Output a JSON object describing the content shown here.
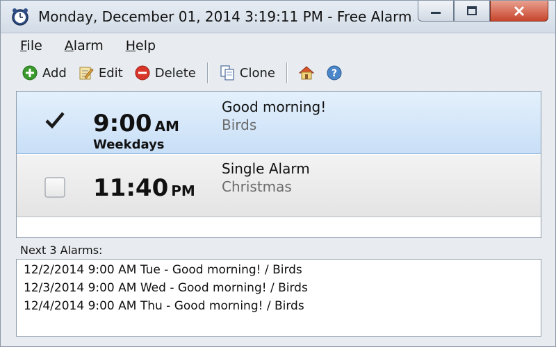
{
  "window": {
    "title": "Monday, December 01, 2014 3:19:11 PM - Free Alarm..."
  },
  "menu": [
    {
      "label_ul": "F",
      "label_rest": "ile"
    },
    {
      "label_ul": "A",
      "label_rest": "larm"
    },
    {
      "label_ul": "H",
      "label_rest": "elp"
    }
  ],
  "toolbar": {
    "add_label": "Add",
    "edit_label": "Edit",
    "delete_label": "Delete",
    "clone_label": "Clone",
    "icons": {
      "add": "add-icon",
      "edit": "edit-icon",
      "delete": "delete-icon",
      "clone": "clone-icon",
      "home": "home-icon",
      "help": "help-icon"
    }
  },
  "alarms": [
    {
      "checked": true,
      "time": "9:00",
      "ampm": "AM",
      "repeat": "Weekdays",
      "title": "Good morning!",
      "sound": "Birds",
      "selected": true
    },
    {
      "checked": false,
      "time": "11:40",
      "ampm": "PM",
      "repeat": "",
      "title": "Single Alarm",
      "sound": "Christmas",
      "selected": false
    }
  ],
  "next": {
    "label": "Next 3 Alarms:",
    "items": [
      "12/2/2014 9:00 AM Tue - Good morning! / Birds",
      "12/3/2014 9:00 AM Wed - Good morning! / Birds",
      "12/4/2014 9:00 AM Thu - Good morning! / Birds"
    ]
  },
  "colors": {
    "selected_row": "#c8dff7",
    "close_button": "#c7452c",
    "add_icon": "#3a9a2e",
    "delete_icon": "#d8362a",
    "help_icon": "#4a86c8"
  }
}
